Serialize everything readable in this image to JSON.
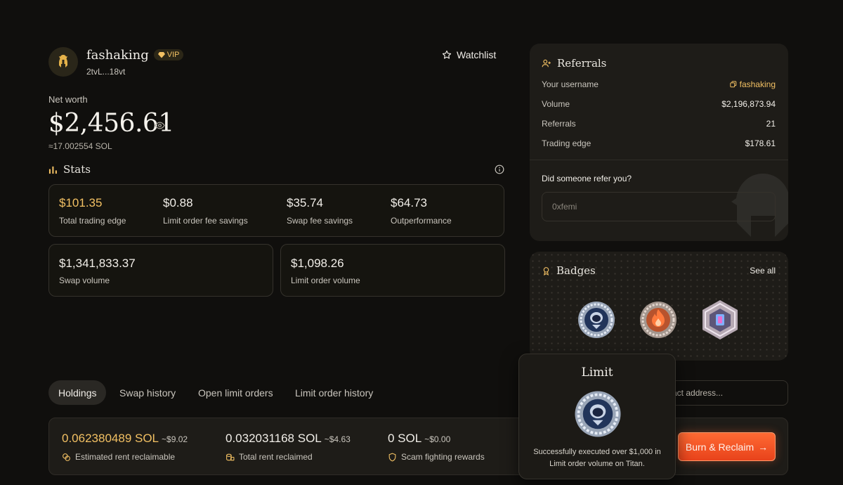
{
  "profile": {
    "username": "fashaking",
    "vip_label": "VIP",
    "address": "2tvL...18vt",
    "watchlist_label": "Watchlist"
  },
  "networth": {
    "label": "Net worth",
    "value": "$2,456.61",
    "sol": "≈17.002554 SOL"
  },
  "stats": {
    "title": "Stats",
    "items": [
      {
        "value": "$101.35",
        "label": "Total trading edge"
      },
      {
        "value": "$0.88",
        "label": "Limit order fee savings"
      },
      {
        "value": "$35.74",
        "label": "Swap fee savings"
      },
      {
        "value": "$64.73",
        "label": "Outperformance"
      }
    ],
    "volumes": [
      {
        "value": "$1,341,833.37",
        "label": "Swap volume"
      },
      {
        "value": "$1,098.26",
        "label": "Limit order volume"
      }
    ]
  },
  "referrals": {
    "title": "Referrals",
    "rows": [
      {
        "key": "Your username",
        "value": "fashaking"
      },
      {
        "key": "Volume",
        "value": "$2,196,873.94"
      },
      {
        "key": "Referrals",
        "value": "21"
      },
      {
        "key": "Trading edge",
        "value": "$178.61"
      }
    ],
    "question": "Did someone refer you?",
    "input_placeholder": "0xfemi"
  },
  "badges": {
    "title": "Badges",
    "see_all": "See all"
  },
  "tabs": [
    "Holdings",
    "Swap history",
    "Open limit orders",
    "Limit order history"
  ],
  "search": {
    "placeholder": "act address..."
  },
  "holdings": [
    {
      "sol": "0.062380489 SOL",
      "usd": "~$9.02",
      "label": "Estimated rent reclaimable"
    },
    {
      "sol": "0.032031168 SOL",
      "usd": "~$4.63",
      "label": "Total rent reclaimed"
    },
    {
      "sol": "0 SOL",
      "usd": "~$0.00",
      "label": "Scam fighting rewards"
    }
  ],
  "burn_button": "Burn & Reclaim",
  "tooltip": {
    "title": "Limit",
    "description": "Successfully executed over $1,000 in Limit order volume on Titan."
  },
  "colors": {
    "accent_gold": "#f2c063",
    "cta_orange": "#ff6a33",
    "background": "#100f0d"
  }
}
